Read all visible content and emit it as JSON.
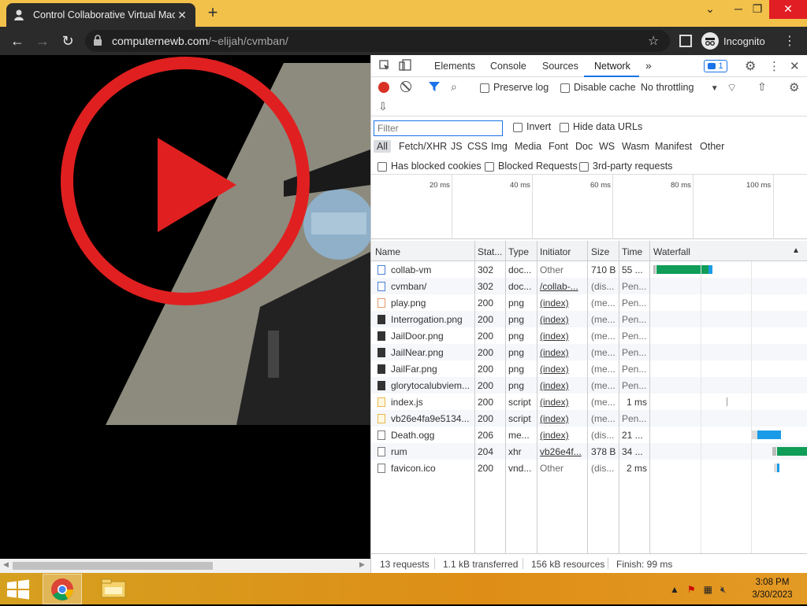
{
  "browser": {
    "tab_title": "Control Collaborative Virtual Mac",
    "tab_close": "✕",
    "new_tab": "+",
    "url_host": "computernewb.com",
    "url_path": "/~elijah/cvmban/",
    "profile_label": "Incognito",
    "window_controls": {
      "minimize": "⌄",
      "restore": "─",
      "maximize": "❐",
      "close": "✕"
    }
  },
  "devtools": {
    "tabs": [
      "Elements",
      "Console",
      "Sources",
      "Network"
    ],
    "more_tabs": "»",
    "issues_count": "1",
    "toolbar": {
      "preserve_log": "Preserve log",
      "disable_cache": "Disable cache",
      "throttling": "No throttling"
    },
    "filter_placeholder": "Filter",
    "invert": "Invert",
    "hide_data_urls": "Hide data URLs",
    "type_filters": [
      "All",
      "Fetch/XHR",
      "JS",
      "CSS",
      "Img",
      "Media",
      "Font",
      "Doc",
      "WS",
      "Wasm",
      "Manifest",
      "Other"
    ],
    "has_blocked_cookies": "Has blocked cookies",
    "blocked_requests": "Blocked Requests",
    "third_party": "3rd-party requests",
    "overview_ticks": [
      "20 ms",
      "40 ms",
      "60 ms",
      "80 ms",
      "100 ms"
    ],
    "columns": [
      "Name",
      "Stat...",
      "Type",
      "Initiator",
      "Size",
      "Time",
      "Waterfall"
    ],
    "rows": [
      {
        "name": "collab-vm",
        "status": "302",
        "type": "doc...",
        "initiator": "Other",
        "size": "710 B",
        "time": "55 ...",
        "icon": "doc"
      },
      {
        "name": "cvmban/",
        "status": "302",
        "type": "doc...",
        "initiator": "/collab-...",
        "size": "(dis...",
        "time": "Pen...",
        "icon": "doc"
      },
      {
        "name": "play.png",
        "status": "200",
        "type": "png",
        "initiator": "(index)",
        "size": "(me...",
        "time": "Pen...",
        "icon": "img-o"
      },
      {
        "name": "Interrogation.png",
        "status": "200",
        "type": "png",
        "initiator": "(index)",
        "size": "(me...",
        "time": "Pen...",
        "icon": "img-d"
      },
      {
        "name": "JailDoor.png",
        "status": "200",
        "type": "png",
        "initiator": "(index)",
        "size": "(me...",
        "time": "Pen...",
        "icon": "img-d"
      },
      {
        "name": "JailNear.png",
        "status": "200",
        "type": "png",
        "initiator": "(index)",
        "size": "(me...",
        "time": "Pen...",
        "icon": "img-d"
      },
      {
        "name": "JailFar.png",
        "status": "200",
        "type": "png",
        "initiator": "(index)",
        "size": "(me...",
        "time": "Pen...",
        "icon": "img-d"
      },
      {
        "name": "glorytocalubviem...",
        "status": "200",
        "type": "png",
        "initiator": "(index)",
        "size": "(me...",
        "time": "Pen...",
        "icon": "img-d"
      },
      {
        "name": "index.js",
        "status": "200",
        "type": "script",
        "initiator": "(index)",
        "size": "(me...",
        "time": "1 ms",
        "icon": "js"
      },
      {
        "name": "vb26e4fa9e5134...",
        "status": "200",
        "type": "script",
        "initiator": "(index)",
        "size": "(me...",
        "time": "Pen...",
        "icon": "js"
      },
      {
        "name": "Death.ogg",
        "status": "206",
        "type": "me...",
        "initiator": "(index)",
        "size": "(dis...",
        "time": "21 ...",
        "icon": "plain"
      },
      {
        "name": "rum",
        "status": "204",
        "type": "xhr",
        "initiator": "vb26e4f...",
        "size": "378 B",
        "time": "34 ...",
        "icon": "plain"
      },
      {
        "name": "favicon.ico",
        "status": "200",
        "type": "vnd...",
        "initiator": "Other",
        "size": "(dis...",
        "time": "2 ms",
        "icon": "plain"
      }
    ],
    "status": {
      "requests": "13 requests",
      "transferred": "1.1 kB transferred",
      "resources": "156 kB resources",
      "finish": "Finish: 99 ms"
    }
  },
  "taskbar": {
    "time": "3:08 PM",
    "date": "3/30/2023"
  },
  "colors": {
    "titlebar": "#f2c14a",
    "accent_blue": "#1a73e8",
    "waterfall_green": "#0f9d58",
    "waterfall_blue": "#1a9be8",
    "record_red": "#d93025"
  }
}
